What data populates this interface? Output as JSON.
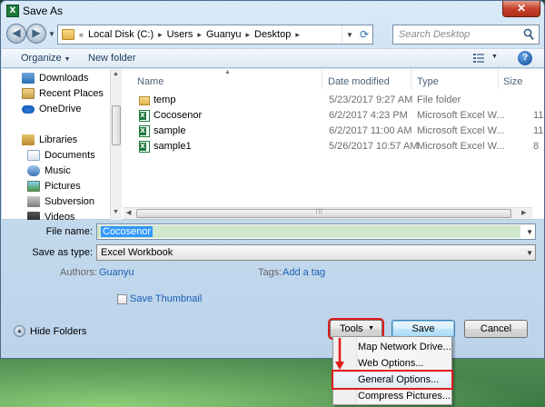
{
  "window": {
    "title": "Save As",
    "app_icon_letter": "X",
    "close_glyph": "✕"
  },
  "nav": {
    "breadcrumb": [
      "Local Disk (C:)",
      "Users",
      "Guanyu",
      "Desktop"
    ],
    "crumb_separator": "▸",
    "overflow": "«",
    "search_placeholder": "Search Desktop"
  },
  "toolbar": {
    "organize": "Organize",
    "new_folder": "New folder",
    "help": "?"
  },
  "sidebar": {
    "items": [
      {
        "label": "Downloads",
        "icon": "downloads-icon"
      },
      {
        "label": "Recent Places",
        "icon": "recent-places-icon"
      },
      {
        "label": "OneDrive",
        "icon": "onedrive-icon"
      },
      {
        "label": "Libraries",
        "icon": "libraries-icon"
      },
      {
        "label": "Documents",
        "icon": "documents-icon"
      },
      {
        "label": "Music",
        "icon": "music-icon"
      },
      {
        "label": "Pictures",
        "icon": "pictures-icon"
      },
      {
        "label": "Subversion",
        "icon": "subversion-icon"
      },
      {
        "label": "Videos",
        "icon": "videos-icon"
      }
    ]
  },
  "columns": {
    "name": "Name",
    "date_modified": "Date modified",
    "type": "Type",
    "size": "Size"
  },
  "files": [
    {
      "name": "temp",
      "date": "5/23/2017 9:27 AM",
      "type": "File folder",
      "size": "",
      "kind": "folder"
    },
    {
      "name": "Cocosenor",
      "date": "6/2/2017 4:23 PM",
      "type": "Microsoft Excel W...",
      "size": "11",
      "kind": "excel"
    },
    {
      "name": "sample",
      "date": "6/2/2017 11:00 AM",
      "type": "Microsoft Excel W...",
      "size": "11",
      "kind": "excel"
    },
    {
      "name": "sample1",
      "date": "5/26/2017 10:57 AM",
      "type": "Microsoft Excel W...",
      "size": "8",
      "kind": "excel"
    }
  ],
  "form": {
    "file_name_label": "File name:",
    "file_name_value": "Cocosenor",
    "save_type_label": "Save as type:",
    "save_type_value": "Excel Workbook",
    "authors_label": "Authors:",
    "authors_value": "Guanyu",
    "tags_label": "Tags:",
    "tags_value": "Add a tag",
    "save_thumbnail": "Save Thumbnail"
  },
  "footer": {
    "hide_folders": "Hide Folders",
    "tools": "Tools",
    "save": "Save",
    "cancel": "Cancel"
  },
  "tools_menu": {
    "items": [
      "Map Network Drive...",
      "Web Options...",
      "General Options...",
      "Compress Pictures..."
    ],
    "highlighted_index": 2
  },
  "colors": {
    "annotation_red": "#e01b1b",
    "selection_blue": "#3399ff",
    "link_blue": "#1a5fb4"
  }
}
